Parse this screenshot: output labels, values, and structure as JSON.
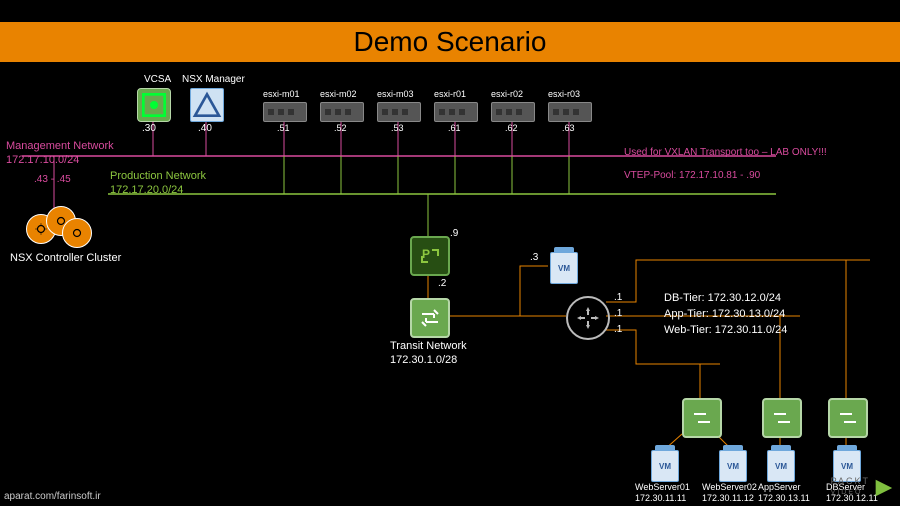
{
  "title": "Demo Scenario",
  "top_nodes": {
    "vcsa": {
      "label": "VCSA"
    },
    "nsx_manager": {
      "label": "NSX Manager"
    }
  },
  "hosts": [
    {
      "name": "esxi-m01",
      "octet": ".51"
    },
    {
      "name": "esxi-m02",
      "octet": ".52"
    },
    {
      "name": "esxi-m03",
      "octet": ".53"
    },
    {
      "name": "esxi-r01",
      "octet": ".61"
    },
    {
      "name": "esxi-r02",
      "octet": ".62"
    },
    {
      "name": "esxi-r03",
      "octet": ".63"
    }
  ],
  "mgmt_net": {
    "label": "Management Network",
    "cidr": "172.17.10.0/24",
    "vcsa_octet": ".30",
    "nsx_octet": ".40",
    "controller_range": ".43 - .45",
    "note_right": "Used for VXLAN Transport too – LAB ONLY!!!",
    "vtep_pool": "VTEP-Pool: 172.17.10.81 - .90"
  },
  "prod_net": {
    "label": "Production Network",
    "cidr": "172.17.20.0/24"
  },
  "nsx_cluster": {
    "label": "NSX Controller Cluster"
  },
  "transit": {
    "name": "Transit Network",
    "cidr": "172.30.1.0/28",
    "ip_edge_top": ".9",
    "ip_edge_bottom": ".2",
    "ip_vm": ".3",
    "ip_router_db": ".1",
    "ip_router_app": ".1",
    "ip_router_web": ".1"
  },
  "tiers": {
    "db": {
      "label": "DB-Tier: 172.30.12.0/24"
    },
    "app": {
      "label": "App-Tier: 172.30.13.0/24"
    },
    "web": {
      "label": "Web-Tier: 172.30.11.0/24"
    }
  },
  "servers": [
    {
      "name": "WebServer01",
      "ip": "172.30.11.11"
    },
    {
      "name": "WebServer02",
      "ip": "172.30.11.12"
    },
    {
      "name": "AppServer",
      "ip": "172.30.13.11"
    },
    {
      "name": "DBServer",
      "ip": "172.30.12.11"
    }
  ],
  "watermark": {
    "brand": "PACKT",
    "sub": "VIDEO"
  },
  "credit": "aparat.com/farinsoft.ir"
}
